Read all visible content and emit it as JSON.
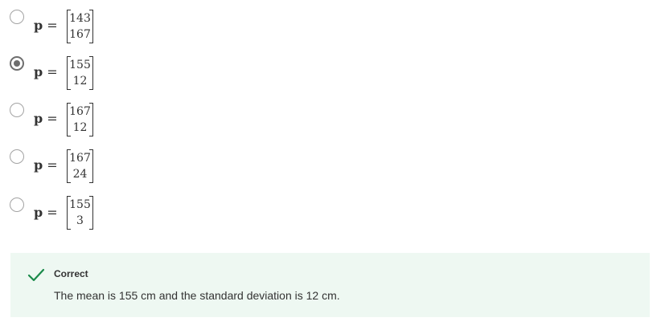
{
  "question": {
    "options": [
      {
        "variable": "p",
        "equals": "=",
        "top": "143",
        "bottom": "167",
        "selected": false
      },
      {
        "variable": "p",
        "equals": "=",
        "top": "155",
        "bottom": "12",
        "selected": true
      },
      {
        "variable": "p",
        "equals": "=",
        "top": "167",
        "bottom": "12",
        "selected": false
      },
      {
        "variable": "p",
        "equals": "=",
        "top": "167",
        "bottom": "24",
        "selected": false
      },
      {
        "variable": "p",
        "equals": "=",
        "top": "155",
        "bottom": "3",
        "selected": false
      }
    ]
  },
  "feedback": {
    "status": "Correct",
    "message": "The mean is 155 cm and the standard deviation is 12 cm.",
    "icon": "checkmark-icon",
    "background_color": "#eef8f2",
    "accent_color": "#1a8a4a"
  }
}
